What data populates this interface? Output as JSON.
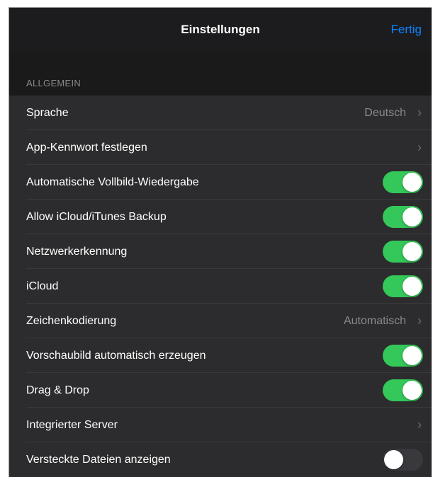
{
  "navbar": {
    "title": "Einstellungen",
    "done_label": "Fertig"
  },
  "section": {
    "header": "ALLGEMEIN"
  },
  "rows": [
    {
      "label": "Sprache",
      "type": "disclosure",
      "value": "Deutsch"
    },
    {
      "label": "App-Kennwort festlegen",
      "type": "disclosure",
      "value": ""
    },
    {
      "label": "Automatische Vollbild-Wiedergabe",
      "type": "toggle",
      "on": true
    },
    {
      "label": "Allow iCloud/iTunes Backup",
      "type": "toggle",
      "on": true
    },
    {
      "label": "Netzwerkerkennung",
      "type": "toggle",
      "on": true
    },
    {
      "label": "iCloud",
      "type": "toggle",
      "on": true
    },
    {
      "label": "Zeichenkodierung",
      "type": "disclosure",
      "value": "Automatisch"
    },
    {
      "label": "Vorschaubild automatisch erzeugen",
      "type": "toggle",
      "on": true
    },
    {
      "label": "Drag & Drop",
      "type": "toggle",
      "on": true
    },
    {
      "label": "Integrierter Server",
      "type": "disclosure",
      "value": ""
    },
    {
      "label": "Versteckte Dateien anzeigen",
      "type": "toggle",
      "on": false
    }
  ],
  "colors": {
    "accent": "#0a84ff",
    "toggle_on": "#34c759",
    "toggle_off": "#39393d",
    "background": "#1c1c1e",
    "cell": "#2c2c2e"
  },
  "icons": {
    "chevron": "chevron-right-icon"
  }
}
